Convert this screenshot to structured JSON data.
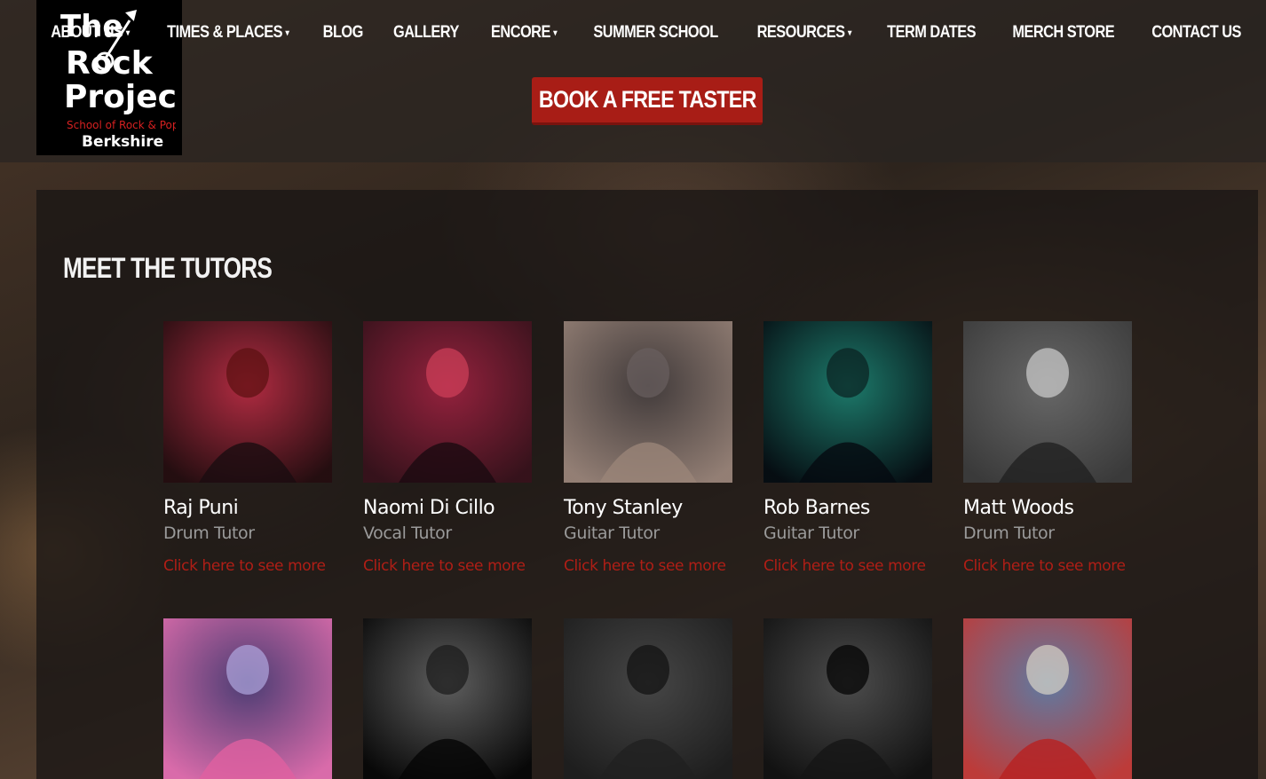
{
  "logo": {
    "line1": "The",
    "line2": "Rock",
    "line3": "Project",
    "tagline": "School of Rock & Pop",
    "region": "Berkshire"
  },
  "nav": [
    {
      "label": "ABOUT US",
      "dropdown": true
    },
    {
      "label": "TIMES & PLACES",
      "dropdown": true
    },
    {
      "label": "BLOG",
      "dropdown": false
    },
    {
      "label": "GALLERY",
      "dropdown": false
    },
    {
      "label": "ENCORE",
      "dropdown": true
    },
    {
      "label": "SUMMER SCHOOL",
      "dropdown": false
    },
    {
      "label": "RESOURCES",
      "dropdown": true
    },
    {
      "label": "TERM DATES",
      "dropdown": false
    },
    {
      "label": "MERCH STORE",
      "dropdown": false
    },
    {
      "label": "CONTACT US",
      "dropdown": false
    }
  ],
  "cta": {
    "label": "BOOK A FREE TASTER"
  },
  "section": {
    "title": "MEET THE TUTORS"
  },
  "tutors": [
    {
      "name": "Raj Puni",
      "role": "Drum Tutor",
      "link": "Click here to see more",
      "photo_colors": [
        "#5a1010",
        "#c0304a",
        "#1a0d10"
      ]
    },
    {
      "name": "Naomi Di Cillo",
      "role": "Vocal Tutor",
      "link": "Click here to see more",
      "photo_colors": [
        "#d0405a",
        "#8a1c38",
        "#1a0a10"
      ]
    },
    {
      "name": "Tony Stanley",
      "role": "Guitar Tutor",
      "link": "Click here to see more",
      "photo_colors": [
        "#6a6060",
        "#3a3434",
        "#9a8478"
      ]
    },
    {
      "name": "Rob Barnes",
      "role": "Guitar Tutor",
      "link": "Click here to see more",
      "photo_colors": [
        "#0a2020",
        "#208a78",
        "#050a10"
      ]
    },
    {
      "name": "Matt Woods",
      "role": "Drum Tutor",
      "link": "Click here to see more",
      "photo_colors": [
        "#cfcfcf",
        "#555555",
        "#202020"
      ]
    }
  ],
  "tutors_row2": [
    {
      "photo_colors": [
        "#b0a8e0",
        "#3a2a60",
        "#e060a0"
      ]
    },
    {
      "photo_colors": [
        "#1a1a1a",
        "#6a6a6a",
        "#050505"
      ]
    },
    {
      "photo_colors": [
        "#101010",
        "#505050",
        "#202020"
      ]
    },
    {
      "photo_colors": [
        "#000000",
        "#5a5a5a",
        "#151515"
      ]
    },
    {
      "photo_colors": [
        "#d8d4c8",
        "#4a6a9a",
        "#b82020"
      ]
    }
  ],
  "colors": {
    "accent": "#a81d16",
    "link": "#b01e16",
    "muted": "#9a9a9a"
  }
}
